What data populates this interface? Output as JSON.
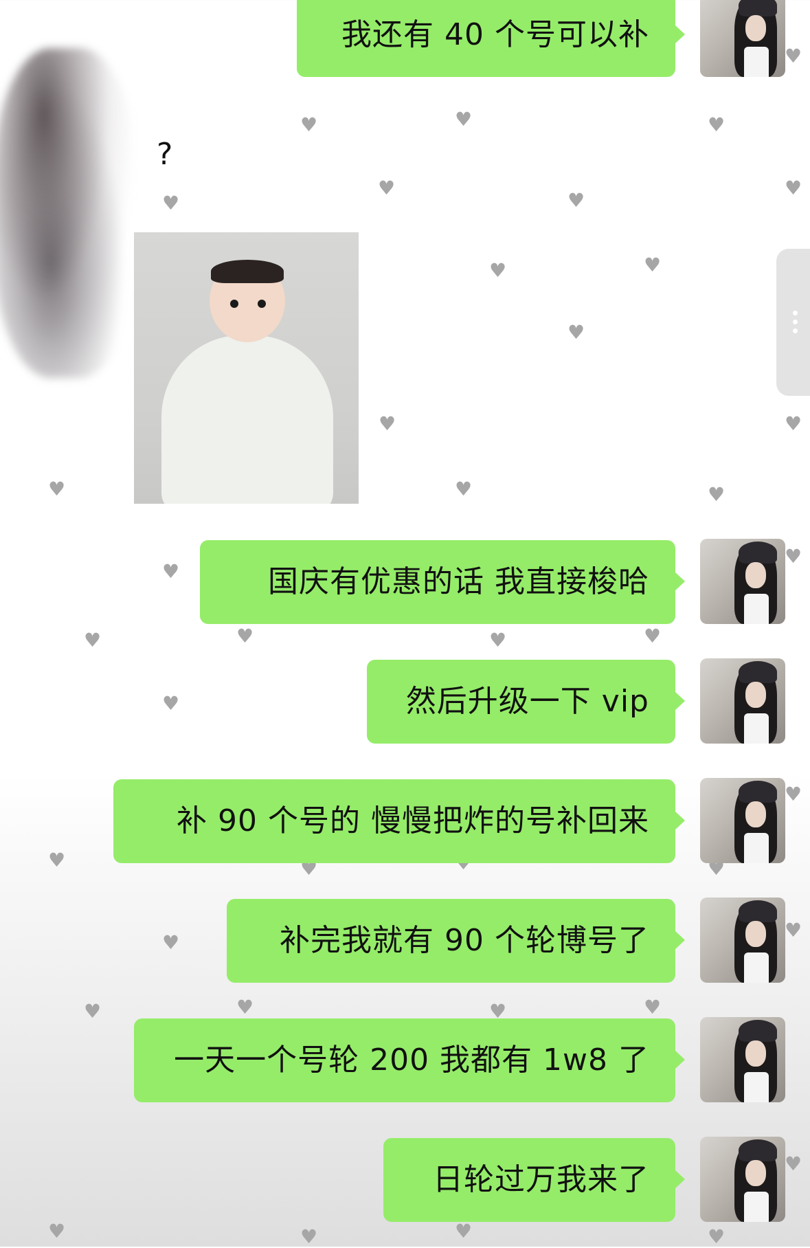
{
  "chat": {
    "incoming": {
      "text": "?"
    },
    "outgoing": [
      {
        "text": "我还有 40 个号可以补"
      },
      {
        "text": "国庆有优惠的话 我直接梭哈"
      },
      {
        "text": "然后升级一下 vip"
      },
      {
        "text": "补 90 个号的 慢慢把炸的号补回来"
      },
      {
        "text": "补完我就有 90 个轮博号了"
      },
      {
        "text": "一天一个号轮 200 我都有 1w8 了"
      },
      {
        "text": "日轮过万我来了"
      }
    ]
  },
  "colors": {
    "bubble_outgoing": "#95ec69",
    "background": "#ffffff"
  },
  "icons": {
    "background_pattern": "heart-icon",
    "scroll": "more-dots-icon"
  }
}
